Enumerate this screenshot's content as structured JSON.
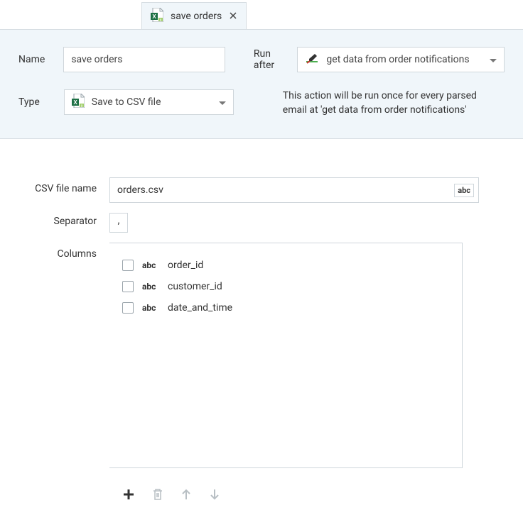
{
  "tab": {
    "title": "save orders"
  },
  "header": {
    "name_label": "Name",
    "name_value": "save orders",
    "type_label": "Type",
    "type_value": "Save to CSV file",
    "runafter_label": "Run after",
    "runafter_value": "get data from order notifications",
    "help_text": "This action will be run once for every parsed email at 'get data from order notifications'"
  },
  "body": {
    "csv_label": "CSV file name",
    "csv_value": "orders.csv",
    "abc_badge": "abc",
    "sep_label": "Separator",
    "sep_value": ",",
    "columns_label": "Columns",
    "columns": [
      {
        "type": "abc",
        "name": "order_id"
      },
      {
        "type": "abc",
        "name": "customer_id"
      },
      {
        "type": "abc",
        "name": "date_and_time"
      }
    ]
  }
}
